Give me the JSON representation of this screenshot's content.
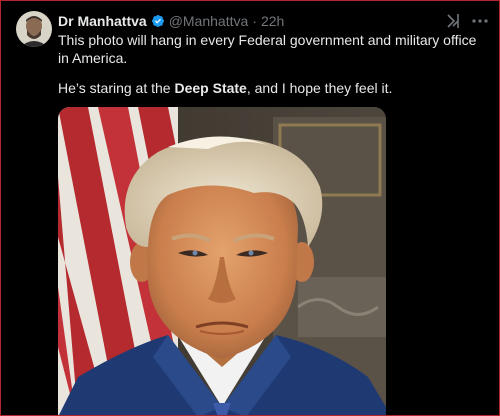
{
  "tweet": {
    "author_name": "Dr Manhattva",
    "handle": "@Manhattva",
    "separator": "·",
    "time": "22h",
    "verified_color": "#1d9bf0",
    "text_line1": "This photo will hang in every Federal government and military office in America.",
    "text_line2_before": "He’s staring at the ",
    "text_line2_bold": "Deep State",
    "text_line2_after": ", and I hope they feel it.",
    "icons": [
      "avatar",
      "verified-badge-icon",
      "grok-icon",
      "more-icon"
    ]
  },
  "colors": {
    "background": "#000000",
    "text": "#e7e9ea",
    "muted": "#71767b",
    "border": "#b3262b"
  }
}
